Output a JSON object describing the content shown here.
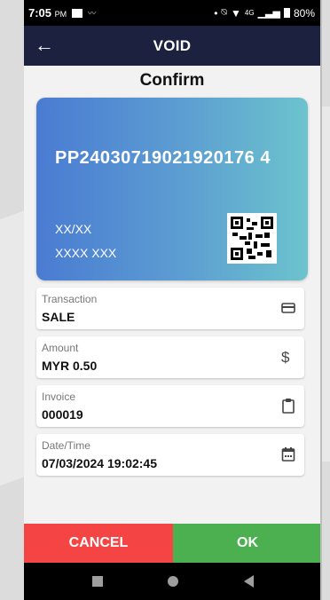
{
  "status_bar": {
    "time": "7:05",
    "ampm": "PM",
    "dot": "•",
    "network": "4G",
    "battery": "80%"
  },
  "app_bar": {
    "title": "VOID",
    "back_icon": "arrow-left-icon"
  },
  "heading": "Confirm",
  "card": {
    "number": "PP24030719021920176 4",
    "expiry": "XX/XX",
    "name": "XXXX XXX",
    "gradient": [
      "#4a7bd2",
      "#6cc3cd"
    ]
  },
  "fields": [
    {
      "label": "Transaction",
      "value": "SALE",
      "icon": "credit-card-icon"
    },
    {
      "label": "Amount",
      "value": "MYR 0.50",
      "icon": "dollar-icon"
    },
    {
      "label": "Invoice",
      "value": "000019",
      "icon": "clipboard-icon"
    },
    {
      "label": "Date/Time",
      "value": "07/03/2024 19:02:45",
      "icon": "calendar-icon"
    }
  ],
  "buttons": {
    "cancel": "CANCEL",
    "ok": "OK",
    "cancel_color": "#f44444",
    "ok_color": "#4caf50"
  },
  "colors": {
    "app_bar": "#1c2140"
  }
}
